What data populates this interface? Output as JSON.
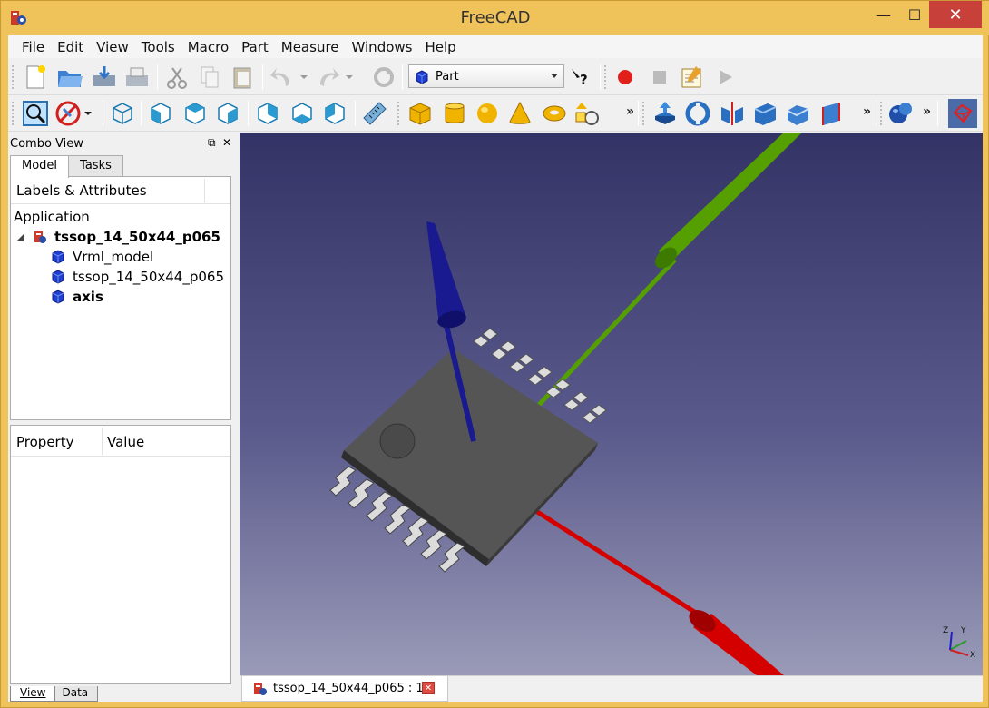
{
  "window": {
    "title": "FreeCAD",
    "minimize": "—",
    "maximize": "☐",
    "close": "✕"
  },
  "menu": [
    "File",
    "Edit",
    "View",
    "Tools",
    "Macro",
    "Part",
    "Measure",
    "Windows",
    "Help"
  ],
  "toolbar": {
    "workbench": "Part",
    "overflow": "»"
  },
  "combo": {
    "title": "Combo View",
    "tabs": [
      "Model",
      "Tasks"
    ],
    "tree_header": "Labels & Attributes",
    "tree_root": "Application",
    "document": "tssop_14_50x44_p065",
    "children": [
      "Vrml_model",
      "tssop_14_50x44_p065",
      "axis"
    ],
    "property_col": "Property",
    "value_col": "Value",
    "bottom_tabs": [
      "View",
      "Data"
    ]
  },
  "viewport": {
    "axis_x": "X",
    "axis_y": "Y",
    "axis_z": "Z"
  },
  "doc_tab": {
    "label": "tssop_14_50x44_p065 : 1*",
    "close": "✕"
  },
  "colors": {
    "title_bar": "#f0c35a",
    "close_button": "#c7403a",
    "axis_red": "#d40000",
    "axis_green": "#55a000",
    "axis_blue": "#1a1a90",
    "chip_body": "#4a4a4a"
  }
}
